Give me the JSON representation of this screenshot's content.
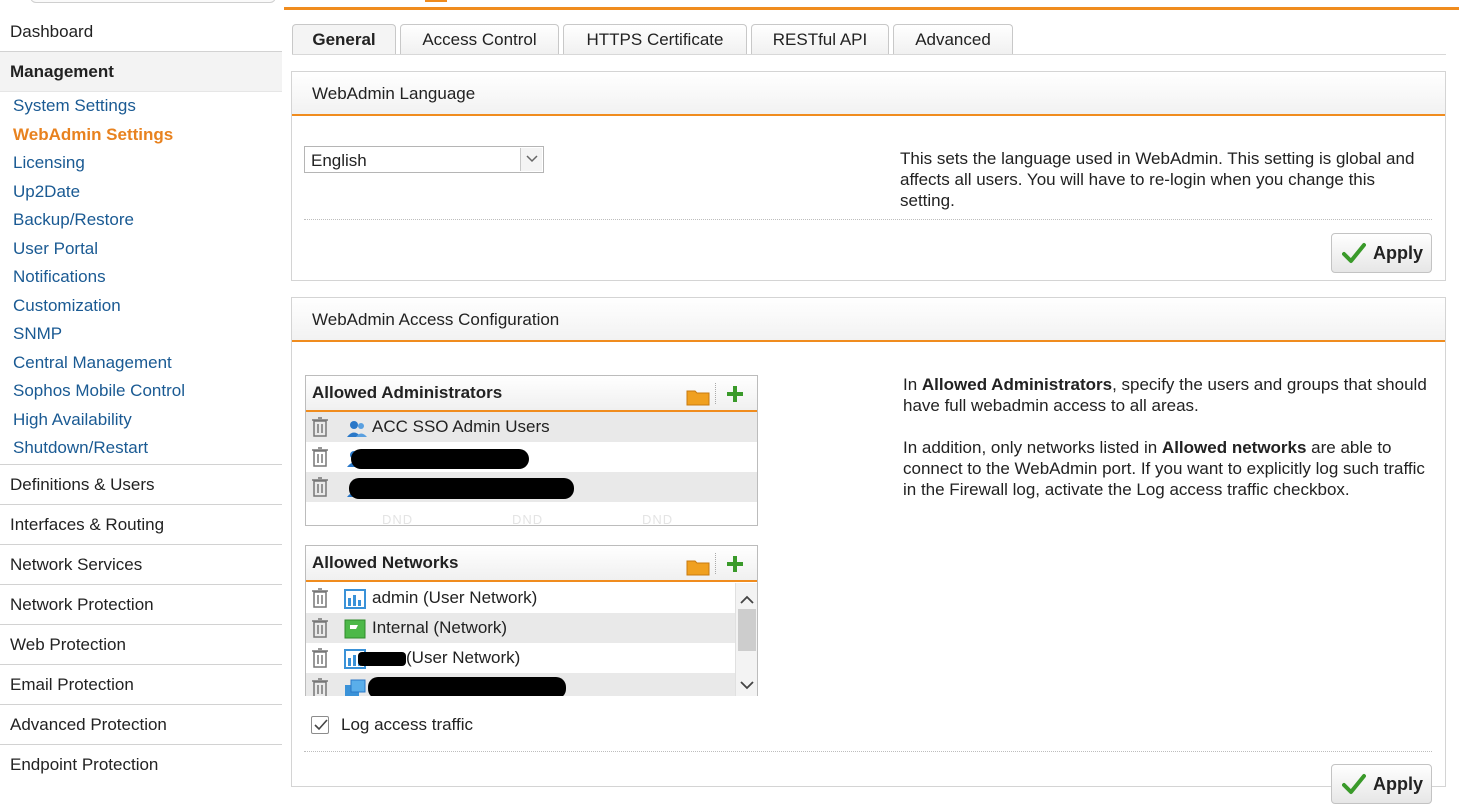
{
  "sidebar": {
    "dashboard": "Dashboard",
    "section": "Management",
    "items": [
      {
        "label": "System Settings",
        "active": false
      },
      {
        "label": "WebAdmin Settings",
        "active": true
      },
      {
        "label": "Licensing",
        "active": false
      },
      {
        "label": "Up2Date",
        "active": false
      },
      {
        "label": "Backup/Restore",
        "active": false
      },
      {
        "label": "User Portal",
        "active": false
      },
      {
        "label": "Notifications",
        "active": false
      },
      {
        "label": "Customization",
        "active": false
      },
      {
        "label": "SNMP",
        "active": false
      },
      {
        "label": "Central Management",
        "active": false
      },
      {
        "label": "Sophos Mobile Control",
        "active": false
      },
      {
        "label": "High Availability",
        "active": false
      },
      {
        "label": "Shutdown/Restart",
        "active": false
      }
    ],
    "groups": [
      "Definitions & Users",
      "Interfaces & Routing",
      "Network Services",
      "Network Protection",
      "Web Protection",
      "Email Protection",
      "Advanced Protection",
      "Endpoint Protection"
    ]
  },
  "tabs": [
    "General",
    "Access Control",
    "HTTPS Certificate",
    "RESTful API",
    "Advanced"
  ],
  "active_tab": "General",
  "language_panel": {
    "title": "WebAdmin Language",
    "selected_language": "English",
    "help": "This sets the language used in WebAdmin. This setting is global and affects all users. You will have to re-login when you change this setting.",
    "apply_label": "Apply"
  },
  "access_panel": {
    "title": "WebAdmin Access Configuration",
    "admins": {
      "title": "Allowed Administrators",
      "rows": [
        "ACC SSO Admin Users",
        "",
        ""
      ],
      "dnd": [
        "DND",
        "DND",
        "DND"
      ]
    },
    "networks": {
      "title": "Allowed Networks",
      "rows": [
        "admin (User Network)",
        "Internal (Network)",
        "(User Network)",
        ""
      ]
    },
    "log_traffic_label": "Log access traffic",
    "log_traffic_checked": true,
    "help": {
      "p1_pre": "In ",
      "p1_bold": "Allowed Administrators",
      "p1_post": ", specify the users and groups that should have full webadmin access to all areas.",
      "p2_pre": "In addition, only networks listed in ",
      "p2_bold": "Allowed networks",
      "p2_post": " are able to connect to the WebAdmin port. If you want to explicitly log such traffic in the Firewall log, activate the Log access traffic checkbox."
    },
    "apply_label": "Apply"
  },
  "colors": {
    "accent": "#f08c1e",
    "link": "#1a5a93",
    "active_link": "#e8821f",
    "apply_check": "#3a9a2a"
  }
}
